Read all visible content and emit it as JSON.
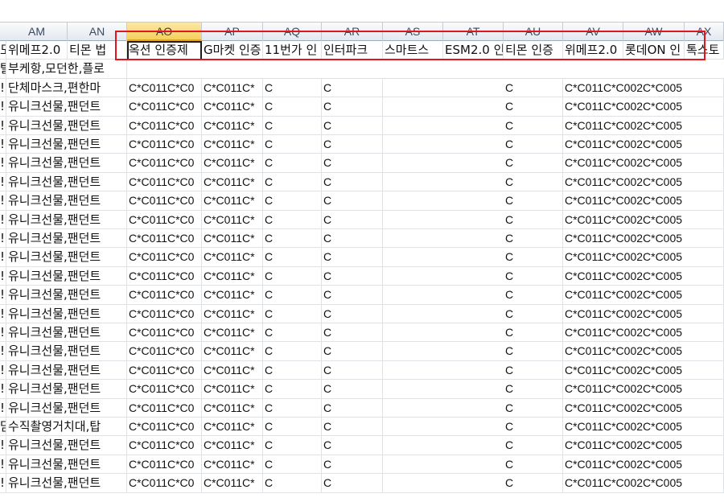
{
  "columns": [
    {
      "label": "AM"
    },
    {
      "label": "AN"
    },
    {
      "label": "AO",
      "active": true
    },
    {
      "label": "AP"
    },
    {
      "label": "AQ"
    },
    {
      "label": "AR"
    },
    {
      "label": "AS"
    },
    {
      "label": "AT"
    },
    {
      "label": "AU"
    },
    {
      "label": "AV"
    },
    {
      "label": "AW"
    },
    {
      "label": "AX"
    }
  ],
  "header_row": [
    "도",
    "위메프2.0",
    "티몬 법",
    "옥션 인증제",
    "G마켓 인증",
    "11번가 인",
    "인터파크",
    "스마트스",
    "ESM2.0 인",
    "티몬 인증",
    "위메프2.0",
    "롯데ON 인",
    "톡스토"
  ],
  "edge_marks": [
    "",
    "탈",
    "!",
    "!",
    "!",
    "!",
    "!",
    "!",
    "!",
    "!",
    "!",
    "!",
    "!",
    "!",
    "!",
    "!",
    "!",
    "!",
    "!",
    "!",
    "담",
    "!",
    "!",
    "!"
  ],
  "product_names": [
    "",
    "부케항,모던한,플로",
    "단체마스크,편한마",
    "유니크선물,팬던트",
    "유니크선물,팬던트",
    "유니크선물,팬던트",
    "유니크선물,팬던트",
    "유니크선물,팬던트",
    "유니크선물,팬던트",
    "유니크선물,팬던트",
    "유니크선물,팬던트",
    "유니크선물,팬던트",
    "유니크선물,팬던트",
    "유니크선물,팬던트",
    "유니크선물,팬던트",
    "유니크선물,팬던트",
    "유니크선물,팬던트",
    "유니크선물,팬던트",
    "유니크선물,팬던트",
    "유니크선물,팬던트",
    "수직촬영거치대,탑",
    "유니크선물,팬던트",
    "유니크선물,팬던트",
    "유니크선물,팬던트"
  ],
  "data_row_template": {
    "ao": "C*C011C*C0",
    "ap": "C*C011C*",
    "aq": "C",
    "ar": "C",
    "au": "C",
    "av": "C*C011C*C002C*C005"
  },
  "styles": {
    "active_header_color": "#f6cf5a",
    "annotation_color": "#e2141c",
    "selection_border": "#1c1c1c"
  }
}
